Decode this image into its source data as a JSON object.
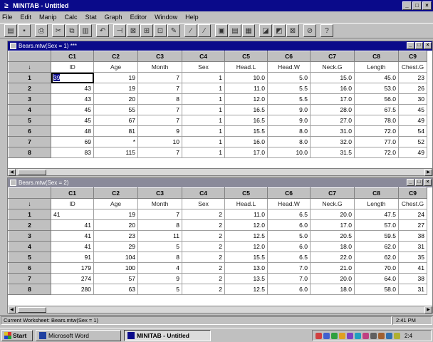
{
  "window": {
    "title": "MINITAB - Untitled"
  },
  "menu": [
    "File",
    "Edit",
    "Manip",
    "Calc",
    "Stat",
    "Graph",
    "Editor",
    "Window",
    "Help"
  ],
  "columns": {
    "ids": [
      "C1",
      "C2",
      "C3",
      "C4",
      "C5",
      "C6",
      "C7",
      "C8",
      "C9"
    ],
    "names": [
      "ID",
      "Age",
      "Month",
      "Sex",
      "Head.L",
      "Head.W",
      "Neck.G",
      "Length",
      "Chest.G"
    ],
    "arrow": "↓"
  },
  "worksheet1": {
    "title": "Bears.mtw(Sex = 1) ***",
    "rows": [
      {
        "n": "1",
        "cells": [
          "39",
          "19",
          "7",
          "1",
          "10.0",
          "5.0",
          "15.0",
          "45.0",
          "23"
        ]
      },
      {
        "n": "2",
        "cells": [
          "43",
          "19",
          "7",
          "1",
          "11.0",
          "5.5",
          "16.0",
          "53.0",
          "26"
        ]
      },
      {
        "n": "3",
        "cells": [
          "43",
          "20",
          "8",
          "1",
          "12.0",
          "5.5",
          "17.0",
          "56.0",
          "30"
        ]
      },
      {
        "n": "4",
        "cells": [
          "45",
          "55",
          "7",
          "1",
          "16.5",
          "9.0",
          "28.0",
          "67.5",
          "45"
        ]
      },
      {
        "n": "5",
        "cells": [
          "45",
          "67",
          "7",
          "1",
          "16.5",
          "9.0",
          "27.0",
          "78.0",
          "49"
        ]
      },
      {
        "n": "6",
        "cells": [
          "48",
          "81",
          "9",
          "1",
          "15.5",
          "8.0",
          "31.0",
          "72.0",
          "54"
        ]
      },
      {
        "n": "7",
        "cells": [
          "69",
          "*",
          "10",
          "1",
          "16.0",
          "8.0",
          "32.0",
          "77.0",
          "52"
        ]
      },
      {
        "n": "8",
        "cells": [
          "83",
          "115",
          "7",
          "1",
          "17.0",
          "10.0",
          "31.5",
          "72.0",
          "49"
        ]
      }
    ]
  },
  "worksheet2": {
    "title": "Bears.mtw(Sex = 2)",
    "rows": [
      {
        "n": "1",
        "cells": [
          "41",
          "19",
          "7",
          "2",
          "11.0",
          "6.5",
          "20.0",
          "47.5",
          "24"
        ]
      },
      {
        "n": "2",
        "cells": [
          "41",
          "20",
          "8",
          "2",
          "12.0",
          "6.0",
          "17.0",
          "57.0",
          "27"
        ]
      },
      {
        "n": "3",
        "cells": [
          "41",
          "23",
          "11",
          "2",
          "12.5",
          "5.0",
          "20.5",
          "59.5",
          "38"
        ]
      },
      {
        "n": "4",
        "cells": [
          "41",
          "29",
          "5",
          "2",
          "12.0",
          "6.0",
          "18.0",
          "62.0",
          "31"
        ]
      },
      {
        "n": "5",
        "cells": [
          "91",
          "104",
          "8",
          "2",
          "15.5",
          "6.5",
          "22.0",
          "62.0",
          "35"
        ]
      },
      {
        "n": "6",
        "cells": [
          "179",
          "100",
          "4",
          "2",
          "13.0",
          "7.0",
          "21.0",
          "70.0",
          "41"
        ]
      },
      {
        "n": "7",
        "cells": [
          "274",
          "57",
          "9",
          "2",
          "13.5",
          "7.0",
          "20.0",
          "64.0",
          "38"
        ]
      },
      {
        "n": "8",
        "cells": [
          "280",
          "63",
          "5",
          "2",
          "12.5",
          "6.0",
          "18.0",
          "58.0",
          "31"
        ]
      }
    ]
  },
  "status": {
    "message": "Current Worksheet: Bears.mtw(Sex = 1)",
    "time": "2:41 PM"
  },
  "taskbar": {
    "start": "Start",
    "tasks": [
      "Microsoft Word",
      "MINITAB - Untitled"
    ],
    "clock": "2:4"
  },
  "colors": {
    "titlebar_active": "#0a0a8a",
    "titlebar_inactive": "#8a8a9a",
    "face": "#c0c0c0"
  }
}
